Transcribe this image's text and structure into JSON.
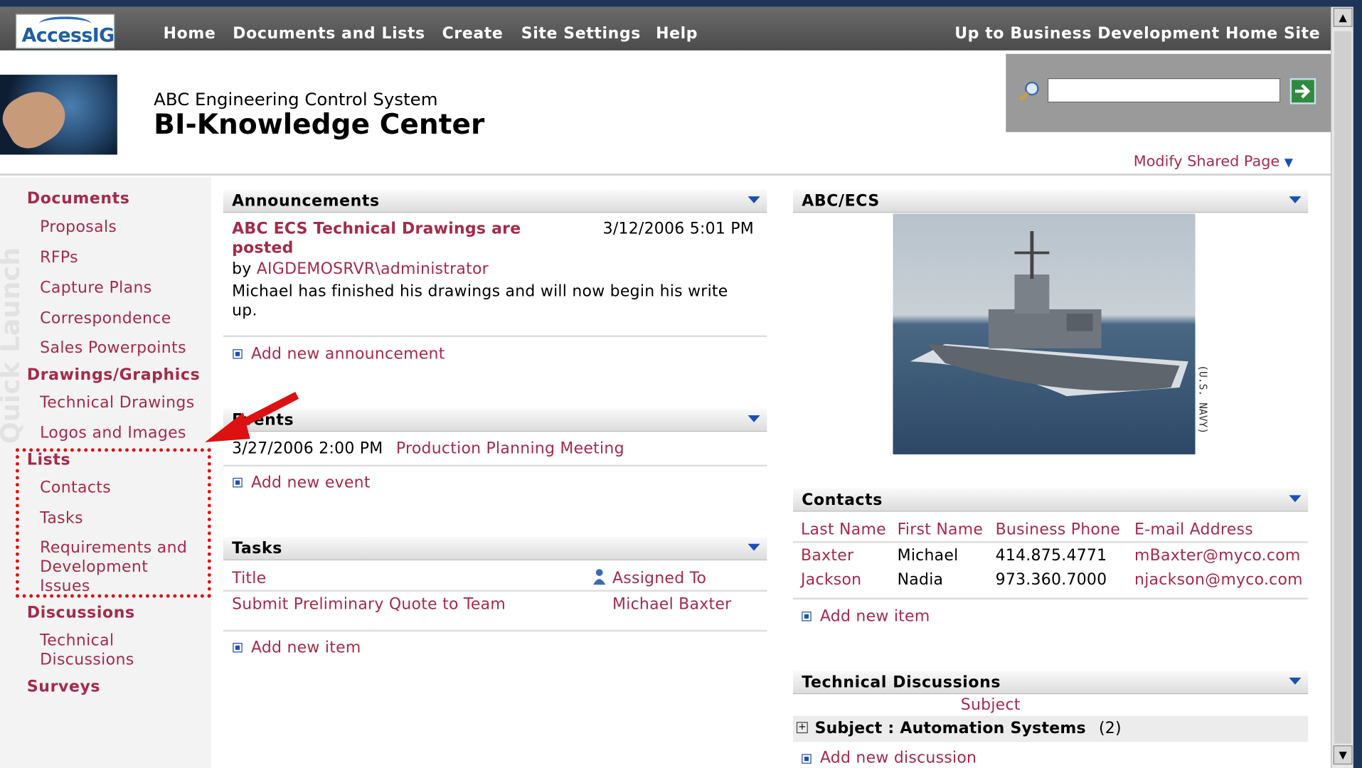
{
  "topnav": {
    "logo": "AccessIG",
    "items": [
      "Home",
      "Documents and Lists",
      "Create",
      "Site Settings",
      "Help"
    ],
    "up_link": "Up to Business Development Home Site"
  },
  "header": {
    "subtitle": "ABC Engineering Control System",
    "title": "BI-Knowledge Center",
    "search_value": "",
    "modify_label": "Modify Shared Page"
  },
  "quicklaunch": {
    "watermark": "Quick Launch",
    "documents": {
      "label": "Documents",
      "items": [
        "Proposals",
        "RFPs",
        "Capture Plans",
        "Correspondence",
        "Sales Powerpoints"
      ]
    },
    "drawings": {
      "label": "Drawings/Graphics",
      "items": [
        "Technical Drawings",
        "Logos and Images"
      ]
    },
    "lists": {
      "label": "Lists",
      "items": [
        "Contacts",
        "Tasks",
        "Requirements and Development Issues"
      ]
    },
    "discussions": {
      "label": "Discussions",
      "items": [
        "Technical Discussions"
      ]
    },
    "surveys": {
      "label": "Surveys"
    }
  },
  "announcements": {
    "header": "Announcements",
    "item_title": "ABC ECS Technical Drawings are posted",
    "item_date": "3/12/2006 5:01 PM",
    "by_prefix": "by",
    "author": "AIGDEMOSRVR\\administrator",
    "body": "Michael has finished his drawings and will now begin his write up.",
    "add_label": "Add new announcement"
  },
  "events": {
    "header": "Events",
    "date": "3/27/2006 2:00 PM",
    "title": "Production Planning Meeting",
    "add_label": "Add new event"
  },
  "tasks": {
    "header": "Tasks",
    "col_title": "Title",
    "col_assigned": "Assigned To",
    "row_title": "Submit Preliminary Quote to Team",
    "row_assigned": "Michael Baxter",
    "add_label": "Add new item"
  },
  "abcecs": {
    "header": "ABC/ECS",
    "caption": "(U.S. NAVY)"
  },
  "contacts": {
    "header": "Contacts",
    "columns": [
      "Last Name",
      "First Name",
      "Business Phone",
      "E-mail Address"
    ],
    "rows": [
      [
        "Baxter",
        "Michael",
        "414.875.4771",
        "mBaxter@myco.com"
      ],
      [
        "Jackson",
        "Nadia",
        "973.360.7000",
        "njackson@myco.com"
      ]
    ],
    "add_label": "Add new item"
  },
  "discussions": {
    "header": "Technical Discussions",
    "col_subject": "Subject",
    "group_label": "Subject : Automation Systems",
    "group_count": "(2)",
    "add_label": "Add new discussion"
  },
  "colors": {
    "link": "#a52a4a",
    "accent": "#1c4fb0",
    "highlight": "#dd1111"
  }
}
